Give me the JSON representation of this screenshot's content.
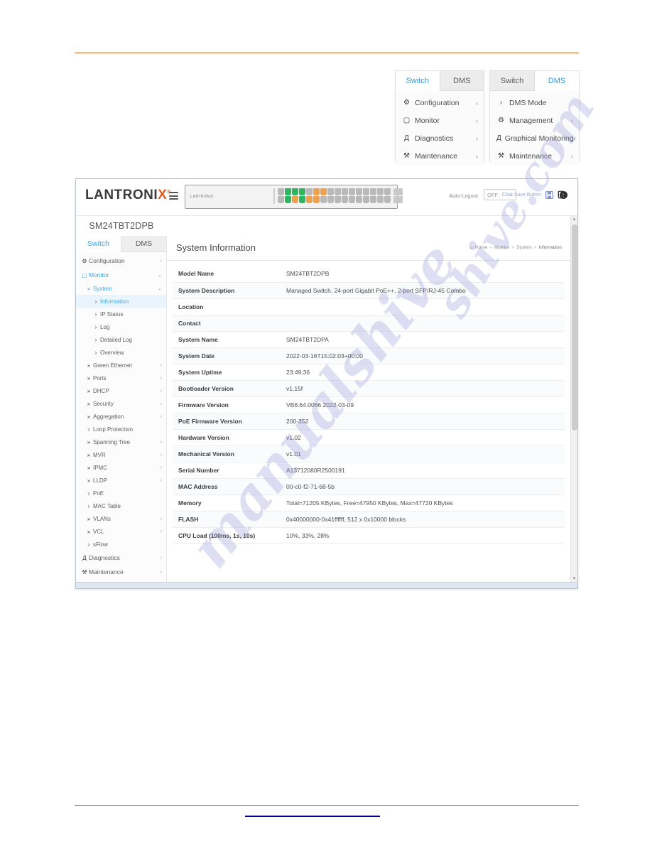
{
  "document": {
    "rule_color": "#c26a28",
    "footer_link_color": "#00008f"
  },
  "watermark": {
    "line1": "shive.com",
    "line2": "manualshive"
  },
  "menu_cards": {
    "switch_card": {
      "tabs": [
        {
          "label": "Switch",
          "active": true
        },
        {
          "label": "DMS",
          "active": false
        }
      ],
      "items": [
        {
          "icon": "gear-icon",
          "glyph": "⚙",
          "label": "Configuration",
          "caret": "‹"
        },
        {
          "icon": "monitor-icon",
          "glyph": "▢",
          "label": "Monitor",
          "caret": "‹"
        },
        {
          "icon": "sitemap-icon",
          "glyph": "Д",
          "label": "Diagnostics",
          "caret": "‹"
        },
        {
          "icon": "wrench-icon",
          "glyph": "⚒",
          "label": "Maintenance",
          "caret": "‹"
        }
      ]
    },
    "dms_card": {
      "tabs": [
        {
          "label": "Switch",
          "active": false
        },
        {
          "label": "DMS",
          "active": true
        }
      ],
      "items": [
        {
          "icon": "chevron-right-icon",
          "glyph": "›",
          "label": "DMS Mode",
          "caret": ""
        },
        {
          "icon": "gear-icon",
          "glyph": "⚙",
          "label": "Management",
          "caret": "‹"
        },
        {
          "icon": "sitemap-icon",
          "glyph": "Д",
          "label": "Graphical Monitoring",
          "caret": "‹"
        },
        {
          "icon": "wrench-icon",
          "glyph": "⚒",
          "label": "Maintenance",
          "caret": "‹"
        }
      ]
    }
  },
  "app": {
    "brand": {
      "text_left": "LANTRONI",
      "text_x": "X",
      "reg": "®"
    },
    "device_image_brand": "LANTRONIX",
    "model": "SM24TBT2DPB",
    "header": {
      "auto_logout_label": "Auto-Logout",
      "auto_logout_value": "OFF",
      "auto_logout_caret": "⌄",
      "save_hint": "Click Save Button",
      "save_icon": "save-icon",
      "help_icon": "help-icon",
      "logout_icon": "logout-icon"
    },
    "sidebar": {
      "tabs": [
        {
          "label": "Switch",
          "active": true
        },
        {
          "label": "DMS",
          "active": false
        }
      ],
      "items": [
        {
          "level": 0,
          "icon": "gear-icon",
          "glyph": "⚙",
          "label": "Configuration",
          "caret": "‹",
          "state": ""
        },
        {
          "level": 0,
          "icon": "monitor-icon",
          "glyph": "▢",
          "label": "Monitor",
          "caret": "⌄",
          "state": "active-blue"
        },
        {
          "level": 1,
          "icon": "chevron-right-icon",
          "glyph": "»",
          "label": "System",
          "caret": "⌄",
          "state": "active-blue"
        },
        {
          "level": 2,
          "icon": "chevron-right-icon",
          "glyph": "›",
          "label": "Information",
          "caret": "",
          "state": "highlight"
        },
        {
          "level": 2,
          "icon": "chevron-right-icon",
          "glyph": "›",
          "label": "IP Status",
          "caret": "",
          "state": ""
        },
        {
          "level": 2,
          "icon": "chevron-right-icon",
          "glyph": "›",
          "label": "Log",
          "caret": "",
          "state": ""
        },
        {
          "level": 2,
          "icon": "chevron-right-icon",
          "glyph": "›",
          "label": "Detailed Log",
          "caret": "",
          "state": ""
        },
        {
          "level": 2,
          "icon": "chevron-right-icon",
          "glyph": "›",
          "label": "Overview",
          "caret": "",
          "state": ""
        },
        {
          "level": 1,
          "icon": "chevron-right-icon",
          "glyph": "»",
          "label": "Green Ethernet",
          "caret": "‹",
          "state": ""
        },
        {
          "level": 1,
          "icon": "chevron-right-icon",
          "glyph": "»",
          "label": "Ports",
          "caret": "‹",
          "state": ""
        },
        {
          "level": 1,
          "icon": "chevron-right-icon",
          "glyph": "»",
          "label": "DHCP",
          "caret": "‹",
          "state": ""
        },
        {
          "level": 1,
          "icon": "chevron-right-icon",
          "glyph": "»",
          "label": "Security",
          "caret": "‹",
          "state": ""
        },
        {
          "level": 1,
          "icon": "chevron-right-icon",
          "glyph": "»",
          "label": "Aggregation",
          "caret": "‹",
          "state": ""
        },
        {
          "level": 1,
          "icon": "chevron-right-icon",
          "glyph": "›",
          "label": "Loop Protection",
          "caret": "",
          "state": ""
        },
        {
          "level": 1,
          "icon": "chevron-right-icon",
          "glyph": "»",
          "label": "Spanning Tree",
          "caret": "‹",
          "state": ""
        },
        {
          "level": 1,
          "icon": "chevron-right-icon",
          "glyph": "»",
          "label": "MVR",
          "caret": "‹",
          "state": ""
        },
        {
          "level": 1,
          "icon": "chevron-right-icon",
          "glyph": "»",
          "label": "IPMC",
          "caret": "‹",
          "state": ""
        },
        {
          "level": 1,
          "icon": "chevron-right-icon",
          "glyph": "»",
          "label": "LLDP",
          "caret": "‹",
          "state": ""
        },
        {
          "level": 1,
          "icon": "chevron-right-icon",
          "glyph": "›",
          "label": "PoE",
          "caret": "",
          "state": ""
        },
        {
          "level": 1,
          "icon": "chevron-right-icon",
          "glyph": "›",
          "label": "MAC Table",
          "caret": "",
          "state": ""
        },
        {
          "level": 1,
          "icon": "chevron-right-icon",
          "glyph": "»",
          "label": "VLANs",
          "caret": "‹",
          "state": ""
        },
        {
          "level": 1,
          "icon": "chevron-right-icon",
          "glyph": "»",
          "label": "VCL",
          "caret": "‹",
          "state": ""
        },
        {
          "level": 1,
          "icon": "chevron-right-icon",
          "glyph": "›",
          "label": "sFlow",
          "caret": "",
          "state": ""
        },
        {
          "level": 0,
          "icon": "sitemap-icon",
          "glyph": "Д",
          "label": "Diagnostics",
          "caret": "‹",
          "state": ""
        },
        {
          "level": 0,
          "icon": "wrench-icon",
          "glyph": "⚒",
          "label": "Maintenance",
          "caret": "‹",
          "state": ""
        }
      ]
    },
    "content": {
      "title": "System Information",
      "breadcrumb": {
        "home_icon": "home-icon",
        "items": [
          "Home",
          "Monitor",
          "System",
          "Information"
        ],
        "separator": "»"
      },
      "table": [
        {
          "key": "Model Name",
          "value": "SM24TBT2DPB"
        },
        {
          "key": "System Description",
          "value": "Managed Switch, 24-port Gigabit PoE++, 2-port SFP/RJ-45 Combo"
        },
        {
          "key": "Location",
          "value": ""
        },
        {
          "key": "Contact",
          "value": ""
        },
        {
          "key": "System Name",
          "value": "SM24TBT2DPA"
        },
        {
          "key": "System Date",
          "value": "2022-03-16T15:02:03+00:00"
        },
        {
          "key": "System Uptime",
          "value": "23:49:36"
        },
        {
          "key": "Bootloader Version",
          "value": "v1.15f"
        },
        {
          "key": "Firmware Version",
          "value": "VB6.64.0066 2022-03-09"
        },
        {
          "key": "PoE Firmware Version",
          "value": "200-352"
        },
        {
          "key": "Hardware Version",
          "value": "v1.02"
        },
        {
          "key": "Mechanical Version",
          "value": "v1.01"
        },
        {
          "key": "Serial Number",
          "value": "A13712080R2500191"
        },
        {
          "key": "MAC Address",
          "value": "00-c0-f2-71-68-5b"
        },
        {
          "key": "Memory",
          "value": "Total=71205 KBytes, Free=47950 KBytes, Max=47720 KBytes"
        },
        {
          "key": "FLASH",
          "value": "0x40000000-0x41ffffff, 512 x 0x10000 blocks"
        },
        {
          "key": "CPU Load (100ms, 1s, 10s)",
          "value": "10%, 33%, 28%"
        }
      ]
    },
    "device_ports": {
      "colors": {
        "green": "#2fb560",
        "orange": "#f0a04b",
        "gray": "#b9b9b9"
      },
      "pairs": [
        {
          "top": "gray",
          "bottom": "gray"
        },
        {
          "top": "green",
          "bottom": "green"
        },
        {
          "top": "green",
          "bottom": "orange"
        },
        {
          "top": "green",
          "bottom": "green"
        },
        {
          "top": "gray",
          "bottom": "orange"
        },
        {
          "top": "orange",
          "bottom": "orange"
        },
        {
          "top": "orange",
          "bottom": "gray"
        },
        {
          "top": "gray",
          "bottom": "gray"
        },
        {
          "top": "gray",
          "bottom": "gray"
        },
        {
          "top": "gray",
          "bottom": "gray"
        },
        {
          "top": "gray",
          "bottom": "gray"
        },
        {
          "top": "gray",
          "bottom": "gray"
        },
        {
          "top": "gray",
          "bottom": "gray"
        },
        {
          "top": "gray",
          "bottom": "gray"
        },
        {
          "top": "gray",
          "bottom": "gray"
        },
        {
          "top": "gray",
          "bottom": "gray"
        }
      ]
    },
    "scrollbar": {
      "up_glyph": "▲",
      "down_glyph": "▼"
    }
  }
}
